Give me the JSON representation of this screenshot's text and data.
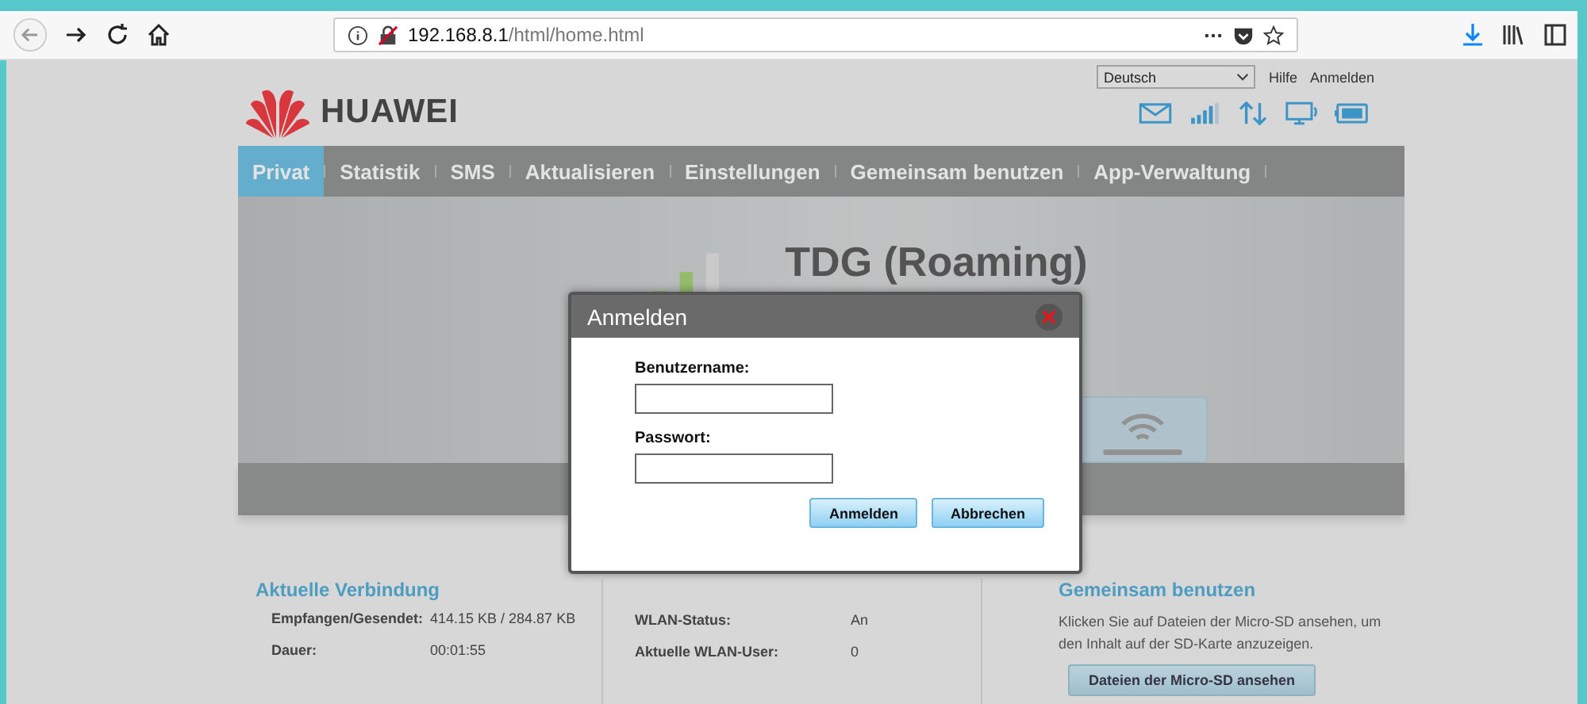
{
  "browser": {
    "url_host": "192.168.8.1",
    "url_path": "/html/home.html"
  },
  "header": {
    "brand": "HUAWEI",
    "language": "Deutsch",
    "links": [
      "Hilfe",
      "Anmelden"
    ]
  },
  "nav": [
    {
      "label": "Privat",
      "selected": true
    },
    {
      "label": "Statistik",
      "selected": false
    },
    {
      "label": "SMS",
      "selected": false
    },
    {
      "label": "Aktualisieren",
      "selected": false
    },
    {
      "label": "Einstellungen",
      "selected": false
    },
    {
      "label": "Gemeinsam benutzen",
      "selected": false
    },
    {
      "label": "App-Verwaltung",
      "selected": false
    }
  ],
  "banner": {
    "network": "TDG (Roaming)"
  },
  "connection": {
    "title": "Aktuelle Verbindung",
    "rows": [
      {
        "label": "Empfangen/Gesendet:",
        "value": "414.15 KB /  284.87 KB"
      },
      {
        "label": "Dauer:",
        "value": "00:01:55"
      }
    ]
  },
  "wlan": {
    "rows": [
      {
        "label": "WLAN-Status:",
        "value": "An"
      },
      {
        "label": "Aktuelle WLAN-User:",
        "value": "0"
      }
    ]
  },
  "sharing": {
    "title": "Gemeinsam benutzen",
    "text": "Klicken Sie auf Dateien der Micro-SD ansehen, um den Inhalt auf der SD-Karte anzuzeigen.",
    "button": "Dateien der Micro-SD ansehen"
  },
  "dialog": {
    "title": "Anmelden",
    "fields": [
      {
        "label": "Benutzername:"
      },
      {
        "label": "Passwort:"
      }
    ],
    "buttons": [
      "Anmelden",
      "Abbrechen"
    ]
  }
}
